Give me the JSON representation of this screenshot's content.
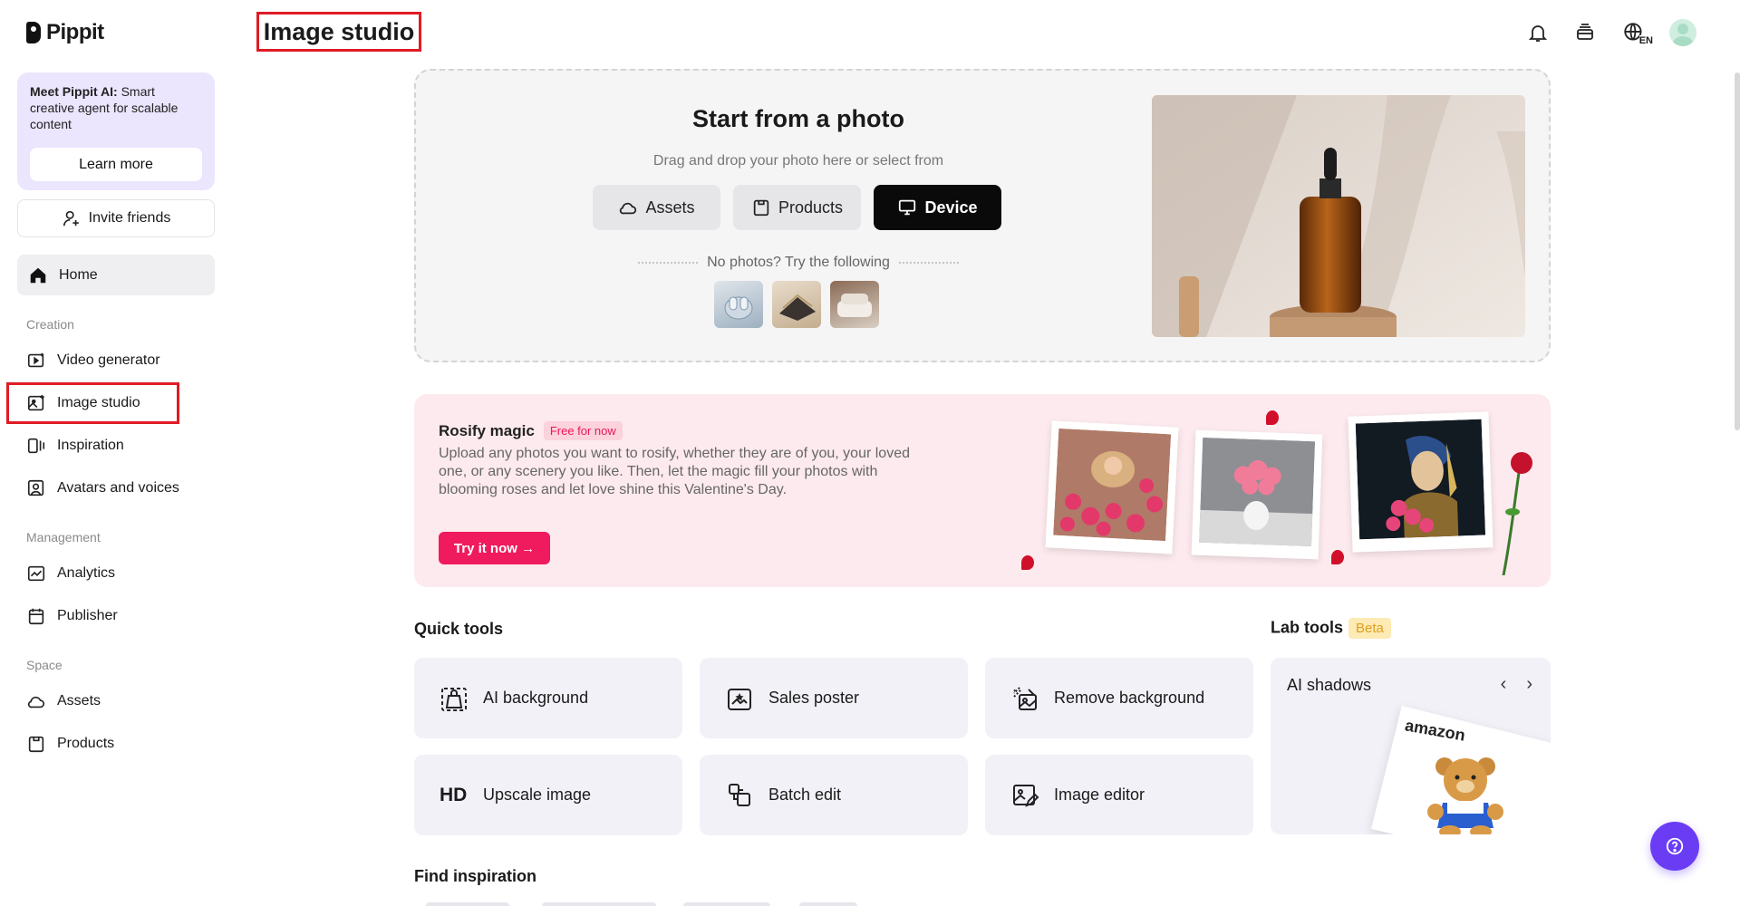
{
  "brand": {
    "name": "Pippit"
  },
  "sidebar": {
    "promo": {
      "title": "Meet Pippit AI:",
      "text": "Smart creative agent for scalable content",
      "button": "Learn more"
    },
    "invite": "Invite friends",
    "home": "Home",
    "sections": {
      "creation": {
        "label": "Creation",
        "items": [
          "Video generator",
          "Image studio",
          "Inspiration",
          "Avatars and voices"
        ]
      },
      "management": {
        "label": "Management",
        "items": [
          "Analytics",
          "Publisher"
        ]
      },
      "space": {
        "label": "Space",
        "items": [
          "Assets",
          "Products"
        ]
      }
    },
    "active_item": "Image studio"
  },
  "header": {
    "title": "Image studio",
    "icons": [
      "bell-icon",
      "layers-icon",
      "language-icon",
      "avatar"
    ],
    "language": "EN"
  },
  "upload": {
    "title": "Start from a photo",
    "subtitle": "Drag and drop your photo here or select from",
    "sources": [
      "Assets",
      "Products",
      "Device"
    ],
    "try_text": "No photos? Try the following"
  },
  "rosify": {
    "title": "Rosify magic",
    "badge": "Free for now",
    "description": "Upload any photos you want to rosify, whether they are of you, your loved one, or any scenery you like. Then, let the magic fill your photos with blooming roses and let love shine this Valentine's Day.",
    "cta": "Try it now →"
  },
  "quick_tools": {
    "heading": "Quick tools",
    "tools": [
      {
        "label": "AI background",
        "icon": "ai-background-icon"
      },
      {
        "label": "Sales poster",
        "icon": "sales-poster-icon"
      },
      {
        "label": "Remove background",
        "icon": "remove-background-icon"
      },
      {
        "label": "Upscale image",
        "icon": "HD"
      },
      {
        "label": "Batch edit",
        "icon": "batch-edit-icon"
      },
      {
        "label": "Image editor",
        "icon": "image-editor-icon"
      }
    ]
  },
  "lab_tools": {
    "heading": "Lab tools",
    "badge": "Beta",
    "card_title": "AI shadows",
    "card_brand": "amazon"
  },
  "find_inspiration": {
    "heading": "Find inspiration"
  },
  "colors": {
    "accent": "#6a3df5",
    "rose": "#f01a5e",
    "highlight": "#e01b24",
    "promo_bg": "#ebe5fd"
  }
}
